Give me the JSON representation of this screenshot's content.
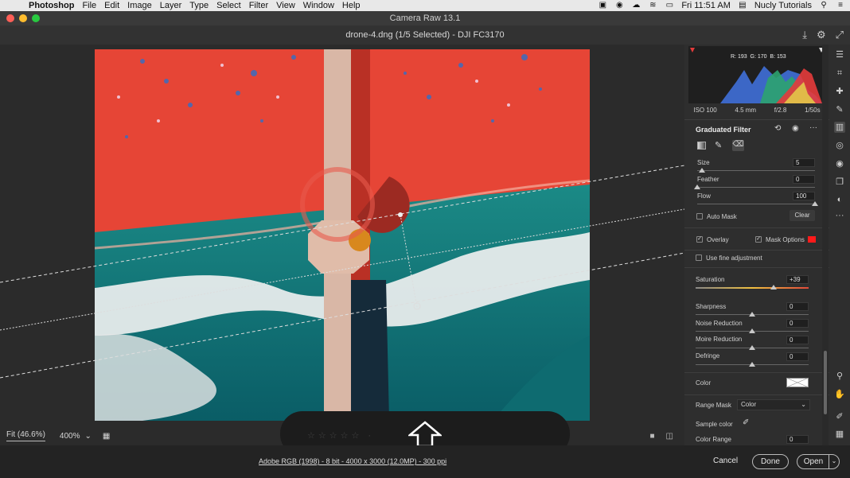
{
  "menubar": {
    "app_name": "Photoshop",
    "items": [
      "File",
      "Edit",
      "Image",
      "Layer",
      "Type",
      "Select",
      "Filter",
      "View",
      "Window",
      "Help"
    ],
    "clock": "Fri 11:51 AM",
    "user": "Nucly Tutorials"
  },
  "window": {
    "title": "Camera Raw 13.1"
  },
  "doc": {
    "title": "drone-4.dng (1/5 Selected)  -  DJI FC3170"
  },
  "histogram": {
    "r": "R: 193",
    "g": "G: 170",
    "b": "B: 153"
  },
  "exif": {
    "iso": "ISO 100",
    "focal": "4.5 mm",
    "aperture": "f/2.8",
    "shutter": "1/50s"
  },
  "panel": {
    "title": "Graduated Filter",
    "brush": {
      "size_label": "Size",
      "size_value": "5",
      "feather_label": "Feather",
      "feather_value": "0",
      "flow_label": "Flow",
      "flow_value": "100"
    },
    "auto_mask": "Auto Mask",
    "clear": "Clear",
    "overlay": "Overlay",
    "mask_options": "Mask Options",
    "fine_adjustment": "Use fine adjustment",
    "saturation_label": "Saturation",
    "saturation_value": "+39",
    "sharpness_label": "Sharpness",
    "sharpness_value": "0",
    "noise_label": "Noise Reduction",
    "noise_value": "0",
    "moire_label": "Moire Reduction",
    "moire_value": "0",
    "defringe_label": "Defringe",
    "defringe_value": "0",
    "color_label": "Color",
    "range_mask_label": "Range Mask",
    "range_mask_value": "Color",
    "sample_color_label": "Sample color",
    "color_range_label": "Color Range",
    "color_range_value": "0"
  },
  "bottombar": {
    "fit": "Fit (46.6%)",
    "zoom": "400%"
  },
  "footer": {
    "info": "Adobe RGB (1998) - 8 bit - 4000 x 3000 (12.0MP) - 300 ppi",
    "cancel": "Cancel",
    "done": "Done",
    "open": "Open"
  },
  "colors": {
    "mask_overlay": "#e8463a",
    "mask_swatch": "#ff1a1a",
    "accent": "#3d8cf0"
  }
}
